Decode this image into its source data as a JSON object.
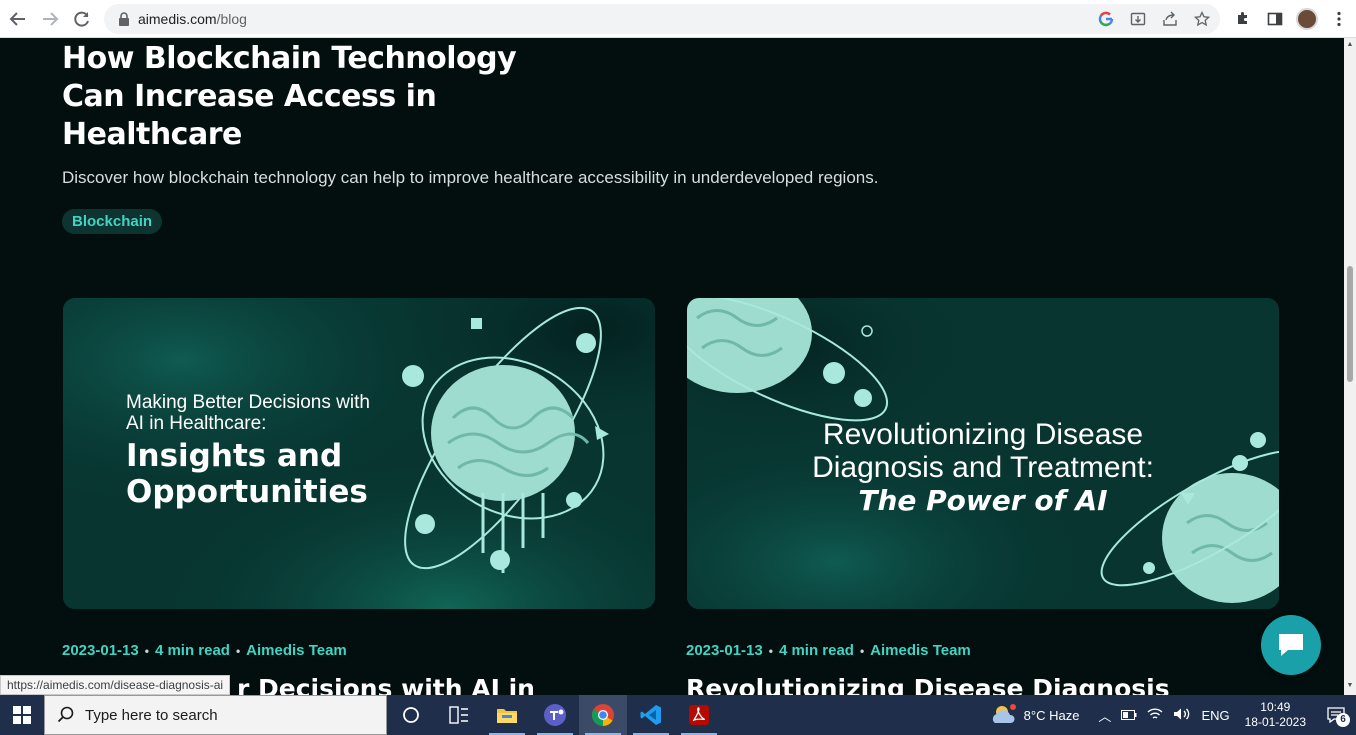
{
  "browser": {
    "url_host": "aimedis.com",
    "url_path": "/blog",
    "icons": [
      "back-icon",
      "forward-icon",
      "reload-icon",
      "lock-icon",
      "google-icon",
      "install-icon",
      "share-icon",
      "star-icon",
      "extensions-icon",
      "sidepanel-icon",
      "profile-avatar",
      "menu-icon"
    ]
  },
  "featured": {
    "title": "How Blockchain Technology Can Increase Access in Healthcare",
    "description": "Discover how blockchain technology can help to improve healthcare accessibility in underdeveloped regions.",
    "tag": "Blockchain"
  },
  "cards": [
    {
      "image_text_small": "Making Better Decisions with AI in Healthcare:",
      "image_text_big": "Insights and Opportunities",
      "date": "2023-01-13",
      "read_time": "4 min read",
      "author": "Aimedis Team",
      "title": "r Decisions with AI in"
    },
    {
      "image_text_line1": "Revolutionizing Disease",
      "image_text_line2": "Diagnosis and Treatment:",
      "image_text_bold": "The Power of AI",
      "date": "2023-01-13",
      "read_time": "4 min read",
      "author": "Aimedis Team",
      "title": "Revolutionizing Disease Diagnosis"
    }
  ],
  "status_bar": {
    "url": "https://aimedis.com/disease-diagnosis-ai"
  },
  "taskbar": {
    "search_placeholder": "Type here to search",
    "apps": [
      "task-view-icon",
      "widgets-icon",
      "file-explorer-icon",
      "teams-icon",
      "chrome-icon",
      "vscode-icon",
      "acrobat-icon"
    ],
    "weather": "8°C  Haze",
    "language": "ENG",
    "time": "10:49",
    "date": "18-01-2023",
    "notification_count": "6"
  },
  "colors": {
    "page_bg": "#020f0e",
    "accent": "#3fd4c4",
    "card_bg": "#083530",
    "chat_button": "#1aa0a8"
  }
}
